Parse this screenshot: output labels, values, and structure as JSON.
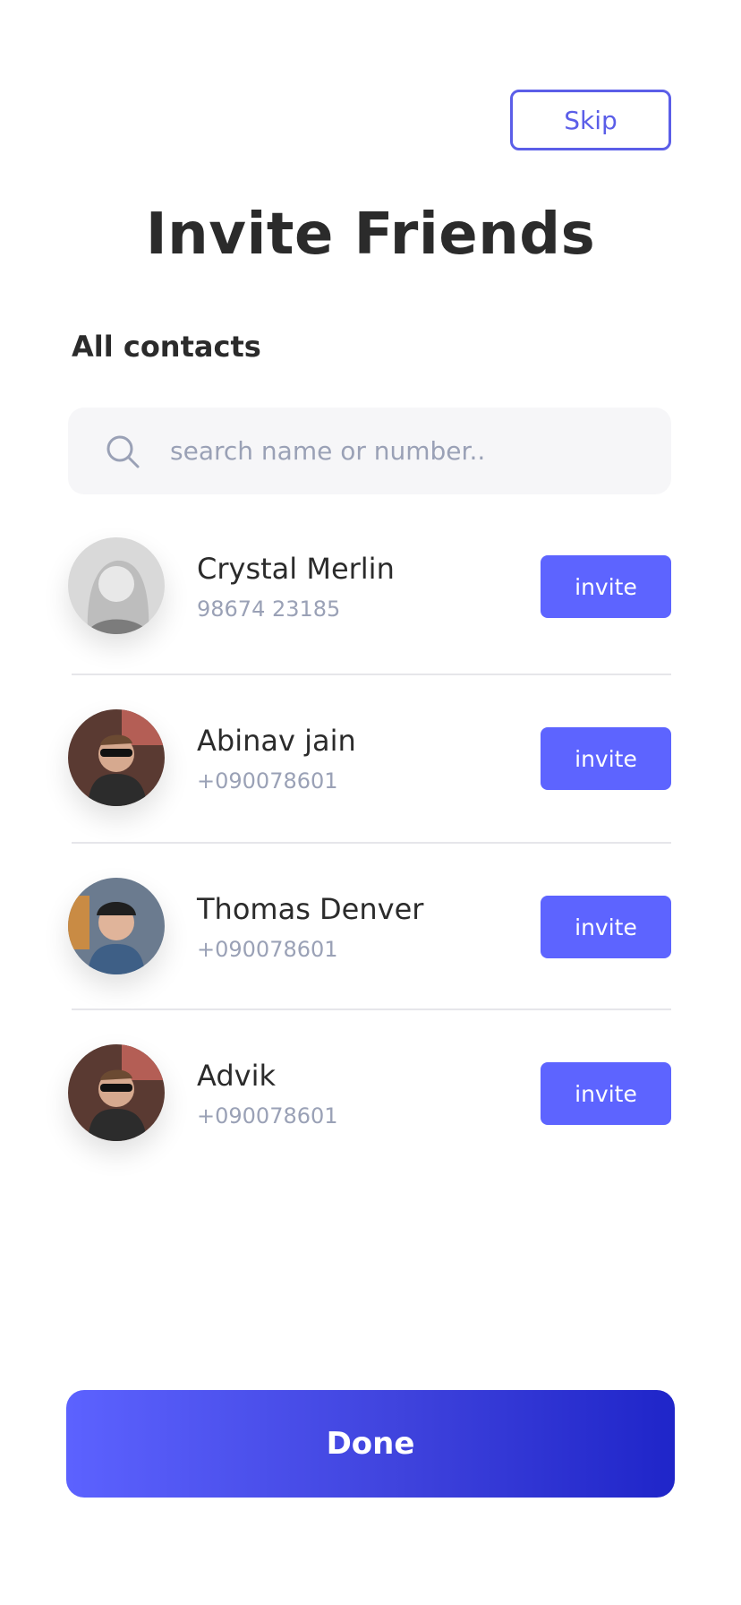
{
  "header": {
    "skip_label": "Skip",
    "title": "Invite Friends"
  },
  "section": {
    "title": "All contacts"
  },
  "search": {
    "placeholder": "search name or number..",
    "icon": "search-icon"
  },
  "contacts": [
    {
      "name": "Crystal Merlin",
      "phone": "98674 23185",
      "action_label": "invite"
    },
    {
      "name": "Abinav jain",
      "phone": "+090078601",
      "action_label": "invite"
    },
    {
      "name": "Thomas Denver",
      "phone": "+090078601",
      "action_label": "invite"
    },
    {
      "name": "Advik",
      "phone": "+090078601",
      "action_label": "invite"
    }
  ],
  "footer": {
    "done_label": "Done"
  },
  "colors": {
    "accent": "#5d64ff",
    "outline_accent": "#5b5ee8",
    "muted_text": "#9aa1b6",
    "search_bg": "#f6f6f8"
  }
}
